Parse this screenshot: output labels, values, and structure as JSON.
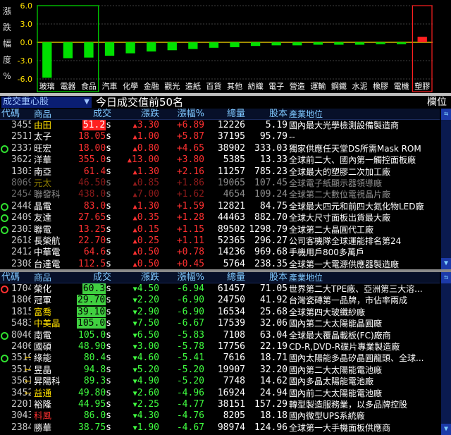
{
  "chart_data": {
    "type": "bar",
    "ylabel_chars": [
      "漲",
      "跌",
      "幅",
      "度",
      "%"
    ],
    "yticks": [
      6.0,
      3.0,
      0.0,
      -3.0,
      -6.0
    ],
    "ytick_labels": [
      "6.0",
      "3.0",
      "0.0",
      "-3.0",
      "-6.0"
    ],
    "ylim": [
      -6.0,
      6.0
    ],
    "categories": [
      "玻璃",
      "電器",
      "食品",
      "汽車",
      "化學",
      "金融",
      "觀光",
      "造紙",
      "百貨",
      "其他",
      "紡織",
      "電子",
      "營造",
      "運輸",
      "鋼鐵",
      "水泥",
      "橡膠",
      "電機",
      "塑膠"
    ],
    "values": [
      -5.8,
      -2.6,
      -2.5,
      -2.2,
      -1.8,
      -1.5,
      -1.3,
      -1.1,
      -0.9,
      -0.8,
      -0.6,
      -0.5,
      -0.5,
      -0.4,
      -0.4,
      -0.4,
      -0.3,
      -0.3,
      0.9
    ],
    "highlight_green": [
      "玻璃",
      "電器",
      "食品"
    ],
    "highlight_red": [
      "塑膠"
    ],
    "colors": {
      "down": "#00e000",
      "up": "#ff2020",
      "axis": "#ffe000",
      "grid": "#555555"
    }
  },
  "header": {
    "left_label": "成交重心股",
    "title": "今日成交值前50名",
    "right_label": "欄位"
  },
  "columns": {
    "code": "代碼",
    "name": "商品",
    "price": "成交",
    "chg": "漲跌",
    "pct": "漲幅%",
    "vol": "總量",
    "cap": "股本",
    "desc": "產業地位"
  },
  "top_rows": [
    {
      "ind": "",
      "code": "3455",
      "name": "由田",
      "name_color": "ylw",
      "price": "51.2",
      "price_style": "bg-red",
      "suffix": "s",
      "dir": "up",
      "chg": "3.30",
      "pct": "+6.89",
      "vol": "12226",
      "cap": "5.19",
      "desc": "國內最大光學檢測設備製造商"
    },
    {
      "ind": "",
      "code": "2511",
      "name": "太子",
      "name_color": "",
      "price": "18.05",
      "price_style": "red",
      "suffix": "s",
      "dir": "up",
      "chg": "1.00",
      "pct": "+5.87",
      "vol": "37195",
      "cap": "95.79",
      "desc": "--"
    },
    {
      "ind": "g",
      "code": "2337",
      "name": "旺宏",
      "name_color": "",
      "price": "18.00",
      "price_style": "red",
      "suffix": "s",
      "dir": "up",
      "chg": "0.80",
      "pct": "+4.65",
      "vol": "38902",
      "cap": "333.03",
      "desc": "獨家供應任天堂DS所需Mask ROM"
    },
    {
      "ind": "",
      "code": "3622",
      "name": "洋華",
      "name_color": "",
      "price": "355.0",
      "price_style": "red",
      "suffix": "s",
      "dir": "up",
      "chg": "13.00",
      "pct": "+3.80",
      "vol": "5385",
      "cap": "13.33",
      "desc": "全球前二大、國內第一觸控面板廠"
    },
    {
      "ind": "",
      "code": "1303",
      "name": "南亞",
      "name_color": "",
      "price": "61.4",
      "price_style": "red",
      "suffix": "s",
      "dir": "up",
      "chg": "1.30",
      "pct": "+2.16",
      "vol": "11257",
      "cap": "785.23",
      "desc": "全球最大的塑膠二次加工廠"
    },
    {
      "ind": "",
      "code": "8069",
      "name": "元太",
      "name_color": "ylw",
      "price": "46.50",
      "price_style": "red",
      "suffix": "s",
      "dir": "up",
      "chg": "0.85",
      "pct": "+1.86",
      "vol": "19065",
      "cap": "107.45",
      "desc": "全球電子紙顯示器領導廠",
      "dim": true
    },
    {
      "ind": "",
      "code": "2454",
      "name": "聯發科",
      "name_color": "",
      "price": "438.0",
      "price_style": "red",
      "suffix": "s",
      "dir": "up",
      "chg": "7.00",
      "pct": "+1.62",
      "vol": "4654",
      "cap": "109.24",
      "desc": "全球第二大數位電視晶片廠",
      "dim": true
    },
    {
      "ind": "g",
      "code": "2448",
      "name": "晶電",
      "name_color": "",
      "price": "83.0",
      "price_style": "red",
      "suffix": "s",
      "dir": "up",
      "chg": "1.30",
      "pct": "+1.59",
      "vol": "12821",
      "cap": "84.75",
      "desc": "全球最大四元和前四大氮化物LED廠"
    },
    {
      "ind": "g",
      "code": "2409",
      "name": "友達",
      "name_color": "",
      "price": "27.65",
      "price_style": "red",
      "suffix": "s",
      "dir": "up",
      "chg": "0.35",
      "pct": "+1.28",
      "vol": "44463",
      "cap": "882.70",
      "desc": "全球大尺寸面板出貨最大廠"
    },
    {
      "ind": "g",
      "code": "2303",
      "name": "聯電",
      "name_color": "",
      "price": "13.25",
      "price_style": "red",
      "suffix": "s",
      "dir": "up",
      "chg": "0.15",
      "pct": "+1.15",
      "vol": "89502",
      "cap": "1298.79",
      "desc": "全球第二大晶圓代工廠"
    },
    {
      "ind": "",
      "code": "2618",
      "name": "長榮航",
      "name_color": "",
      "price": "22.70",
      "price_style": "red",
      "suffix": "s",
      "dir": "up",
      "chg": "0.25",
      "pct": "+1.11",
      "vol": "52365",
      "cap": "296.27",
      "desc": "公司客機隊全球運能排名第24"
    },
    {
      "ind": "",
      "code": "2412",
      "name": "中華電",
      "name_color": "",
      "price": "64.6",
      "price_style": "red",
      "suffix": "s",
      "dir": "up",
      "chg": "0.50",
      "pct": "+0.78",
      "vol": "14236",
      "cap": "969.68",
      "desc": "手機用戶800多萬戶"
    },
    {
      "ind": "",
      "code": "2308",
      "name": "台達電",
      "name_color": "",
      "price": "112.5",
      "price_style": "red",
      "suffix": "s",
      "dir": "up",
      "chg": "0.50",
      "pct": "+0.45",
      "vol": "5764",
      "cap": "238.35",
      "desc": "全球第一大電源供應器製造廠"
    }
  ],
  "bottom_rows": [
    {
      "ind": "r",
      "code": "1704",
      "name": "榮化",
      "name_color": "",
      "price": "60.3",
      "price_style": "bg-grn",
      "suffix": "s",
      "dir": "down",
      "chg": "4.50",
      "pct": "-6.94",
      "vol": "61457",
      "cap": "71.05",
      "desc": "世界第二大TPE廠、亞洲第三大溶..."
    },
    {
      "ind": "",
      "code": "1806",
      "name": "冠軍",
      "name_color": "",
      "price": "29.70",
      "price_style": "bg-grn",
      "suffix": "s",
      "dir": "down",
      "chg": "2.20",
      "pct": "-6.90",
      "vol": "24750",
      "cap": "41.92",
      "desc": "台灣瓷磚第一品牌，市佔率兩成"
    },
    {
      "ind": "",
      "code": "1815",
      "name": "富喬",
      "name_color": "ylw",
      "price": "39.10",
      "price_style": "bg-grn",
      "suffix": "s",
      "dir": "down",
      "chg": "2.90",
      "pct": "-6.90",
      "vol": "16534",
      "cap": "25.68",
      "desc": "全球第四大玻纖紗廠"
    },
    {
      "ind": "",
      "code": "5483",
      "name": "中美晶",
      "name_color": "ylw",
      "price": "105.0",
      "price_style": "bg-grn",
      "suffix": "s",
      "dir": "down",
      "chg": "7.50",
      "pct": "-6.67",
      "vol": "17539",
      "cap": "32.06",
      "desc": "國內第二大太陽能晶圓廠"
    },
    {
      "ind": "g",
      "code": "8046",
      "name": "南電",
      "name_color": "",
      "price": "105.0",
      "price_style": "grn",
      "suffix": "s",
      "dir": "down",
      "chg": "6.50",
      "pct": "-5.83",
      "vol": "7108",
      "cap": "63.04",
      "desc": "全球最大覆晶載板(FC)廠商"
    },
    {
      "ind": "",
      "code": "2406",
      "name": "國碩",
      "name_color": "",
      "price": "48.90",
      "price_style": "grn",
      "suffix": "s",
      "dir": "down",
      "chg": "3.00",
      "pct": "-5.78",
      "vol": "17756",
      "cap": "22.19",
      "desc": "CD-R,DVD-R碟片專業製造廠"
    },
    {
      "ind": "g",
      "code": "3519",
      "name": "綠能",
      "name_color": "",
      "price": "80.4",
      "price_style": "grn",
      "suffix": "s",
      "dir": "down",
      "chg": "4.60",
      "pct": "-5.41",
      "vol": "7616",
      "cap": "18.71",
      "desc": "國內太陽能多晶矽晶圓龍頭、全球...",
      "arrow": true
    },
    {
      "ind": "",
      "code": "3514",
      "name": "昱晶",
      "name_color": "",
      "price": "94.8",
      "price_style": "grn",
      "suffix": "s",
      "dir": "down",
      "chg": "5.20",
      "pct": "-5.20",
      "vol": "19907",
      "cap": "32.20",
      "desc": "國內第二大太陽能電池廠",
      "arrow": true
    },
    {
      "ind": "",
      "code": "3561",
      "name": "昇陽科",
      "name_color": "",
      "price": "89.3",
      "price_style": "grn",
      "suffix": "s",
      "dir": "down",
      "chg": "4.90",
      "pct": "-5.20",
      "vol": "7748",
      "cap": "14.62",
      "desc": "國內多晶太陽能電池廠",
      "arrow": true
    },
    {
      "ind": "",
      "code": "3452",
      "name": "益通",
      "name_color": "ylw",
      "price": "49.80",
      "price_style": "grn",
      "suffix": "s",
      "dir": "down",
      "chg": "2.60",
      "pct": "-4.96",
      "vol": "16924",
      "cap": "24.94",
      "desc": "國內前二大太陽能電池廠",
      "arrow": true
    },
    {
      "ind": "",
      "code": "2201",
      "name": "裕隆",
      "name_color": "",
      "price": "44.95",
      "price_style": "grn",
      "suffix": "s",
      "dir": "down",
      "chg": "2.25",
      "pct": "-4.77",
      "vol": "38151",
      "cap": "157.29",
      "desc": "轉型製造服務業，以多品牌控股"
    },
    {
      "ind": "",
      "code": "3043",
      "name": "科風",
      "name_color": "red",
      "price": "86.0",
      "price_style": "grn",
      "suffix": "s",
      "dir": "down",
      "chg": "4.30",
      "pct": "-4.76",
      "vol": "8205",
      "cap": "18.18",
      "desc": "國內微型UPS系統廠"
    },
    {
      "ind": "",
      "code": "2384",
      "name": "勝華",
      "name_color": "",
      "price": "38.75",
      "price_style": "grn",
      "suffix": "s",
      "dir": "down",
      "chg": "1.90",
      "pct": "-4.67",
      "vol": "98974",
      "cap": "124.96",
      "desc": "全球第一大手機面板供應商"
    }
  ],
  "icons": {
    "scroll_up": "arrow-up-icon",
    "scroll_down": "arrow-down-icon",
    "swap": "swap-icon"
  }
}
